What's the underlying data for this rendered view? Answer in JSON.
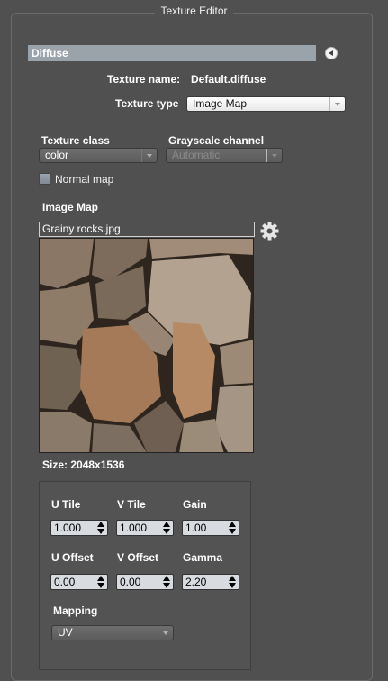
{
  "panel": {
    "title": "Texture Editor"
  },
  "channel": {
    "label": "Diffuse"
  },
  "texture": {
    "name_label": "Texture name:",
    "name_value": "Default.diffuse",
    "type_label": "Texture type",
    "type_value": "Image Map",
    "class_label": "Texture class",
    "class_value": "color",
    "grayscale_label": "Grayscale channel",
    "grayscale_value": "Automatic",
    "normal_map_label": "Normal map",
    "normal_map_checked": false
  },
  "image_map": {
    "section_label": "Image Map",
    "file_name": "Grainy rocks.jpg",
    "size_text": "Size:  2048x1536"
  },
  "params": {
    "u_tile_label": "U Tile",
    "u_tile_value": "1.000",
    "v_tile_label": "V Tile",
    "v_tile_value": "1.000",
    "gain_label": "Gain",
    "gain_value": "1.00",
    "u_offset_label": "U Offset",
    "u_offset_value": "0.00",
    "v_offset_label": "V Offset",
    "v_offset_value": "0.00",
    "gamma_label": "Gamma",
    "gamma_value": "2.20",
    "mapping_label": "Mapping",
    "mapping_value": "UV"
  },
  "icons": {
    "collapse": "triangle-left-icon",
    "settings": "gear-icon"
  },
  "colors": {
    "background": "#505050",
    "channel_bar": "#9aa2aa"
  }
}
